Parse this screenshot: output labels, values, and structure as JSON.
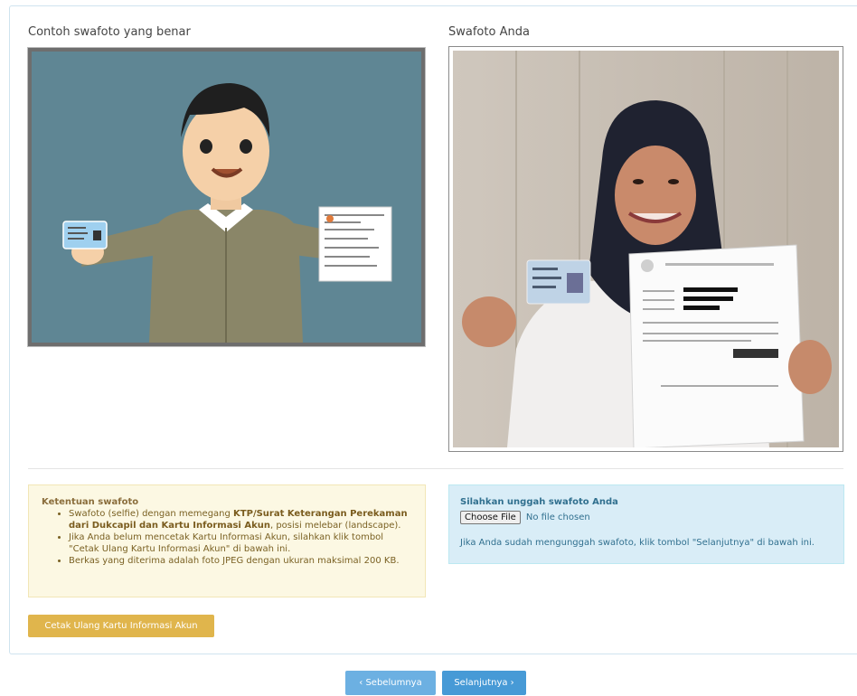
{
  "captions": {
    "example": "Contoh swafoto yang benar",
    "yours": "Swafoto Anda"
  },
  "images": {
    "example": "selfie-example-illustration",
    "yours": "user-selfie-photo"
  },
  "rules": {
    "title": "Ketentuan swafoto",
    "item1_pre": "Swafoto (selfie) dengan memegang ",
    "item1_bold": "KTP/Surat Keterangan Perekaman dari Dukcapil dan Kartu Informasi Akun",
    "item1_post": ", posisi melebar (landscape).",
    "item2": "Jika Anda belum mencetak Kartu Informasi Akun, silahkan klik tombol \"Cetak Ulang Kartu Informasi Akun\" di bawah ini.",
    "item3": "Berkas yang diterima adalah foto JPEG dengan ukuran maksimal 200 KB."
  },
  "upload": {
    "title": "Silahkan unggah swafoto Anda",
    "choose_label": "Choose File",
    "file_status": "No file chosen",
    "hint": "Jika Anda sudah mengunggah swafoto, klik tombol \"Selanjutnya\" di bawah ini."
  },
  "buttons": {
    "reprint": "Cetak Ulang Kartu Informasi Akun",
    "prev": "‹ Sebelumnya",
    "next": "Selanjutnya ›"
  },
  "colors": {
    "warning_bg": "#fcf8e3",
    "info_bg": "#d9edf7",
    "gold_button": "#e0b54c",
    "primary_button": "#479ad6"
  }
}
